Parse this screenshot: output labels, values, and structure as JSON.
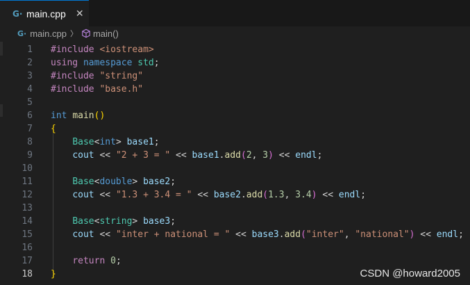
{
  "tab": {
    "label": "main.cpp",
    "close": "✕"
  },
  "breadcrumb": {
    "file": "main.cpp",
    "separator": "〉",
    "symbol": "main()"
  },
  "editor": {
    "active_line": 18,
    "line_numbers": [
      "1",
      "2",
      "3",
      "4",
      "5",
      "6",
      "7",
      "8",
      "9",
      "10",
      "11",
      "12",
      "13",
      "14",
      "15",
      "16",
      "17",
      "18"
    ],
    "lines": [
      [
        [
          "pp",
          "#include "
        ],
        [
          "str",
          "<iostream>"
        ]
      ],
      [
        [
          "pp",
          "using "
        ],
        [
          "kw",
          "namespace "
        ],
        [
          "ty",
          "std"
        ],
        [
          "op",
          ";"
        ]
      ],
      [
        [
          "pp",
          "#include "
        ],
        [
          "str",
          "\"string\""
        ]
      ],
      [
        [
          "pp",
          "#include "
        ],
        [
          "str",
          "\"base.h\""
        ]
      ],
      [],
      [
        [
          "kw",
          "int "
        ],
        [
          "fn",
          "main"
        ],
        [
          "br1",
          "()"
        ]
      ],
      [
        [
          "br1",
          "{"
        ]
      ],
      [
        [
          "op",
          "    "
        ],
        [
          "ty",
          "Base"
        ],
        [
          "op",
          "<"
        ],
        [
          "kw",
          "int"
        ],
        [
          "op",
          "> "
        ],
        [
          "var",
          "base1"
        ],
        [
          "op",
          ";"
        ]
      ],
      [
        [
          "op",
          "    "
        ],
        [
          "var",
          "cout"
        ],
        [
          "op",
          " << "
        ],
        [
          "str",
          "\"2 + 3 = \""
        ],
        [
          "op",
          " << "
        ],
        [
          "var",
          "base1"
        ],
        [
          "op",
          "."
        ],
        [
          "fn",
          "add"
        ],
        [
          "br2",
          "("
        ],
        [
          "num",
          "2"
        ],
        [
          "op",
          ", "
        ],
        [
          "num",
          "3"
        ],
        [
          "br2",
          ")"
        ],
        [
          "op",
          " << "
        ],
        [
          "var",
          "endl"
        ],
        [
          "op",
          ";"
        ]
      ],
      [],
      [
        [
          "op",
          "    "
        ],
        [
          "ty",
          "Base"
        ],
        [
          "op",
          "<"
        ],
        [
          "kw",
          "double"
        ],
        [
          "op",
          "> "
        ],
        [
          "var",
          "base2"
        ],
        [
          "op",
          ";"
        ]
      ],
      [
        [
          "op",
          "    "
        ],
        [
          "var",
          "cout"
        ],
        [
          "op",
          " << "
        ],
        [
          "str",
          "\"1.3 + 3.4 = \""
        ],
        [
          "op",
          " << "
        ],
        [
          "var",
          "base2"
        ],
        [
          "op",
          "."
        ],
        [
          "fn",
          "add"
        ],
        [
          "br2",
          "("
        ],
        [
          "num",
          "1.3"
        ],
        [
          "op",
          ", "
        ],
        [
          "num",
          "3.4"
        ],
        [
          "br2",
          ")"
        ],
        [
          "op",
          " << "
        ],
        [
          "var",
          "endl"
        ],
        [
          "op",
          ";"
        ]
      ],
      [],
      [
        [
          "op",
          "    "
        ],
        [
          "ty",
          "Base"
        ],
        [
          "op",
          "<"
        ],
        [
          "ty",
          "string"
        ],
        [
          "op",
          "> "
        ],
        [
          "var",
          "base3"
        ],
        [
          "op",
          ";"
        ]
      ],
      [
        [
          "op",
          "    "
        ],
        [
          "var",
          "cout"
        ],
        [
          "op",
          " << "
        ],
        [
          "str",
          "\"inter + national = \""
        ],
        [
          "op",
          " << "
        ],
        [
          "var",
          "base3"
        ],
        [
          "op",
          "."
        ],
        [
          "fn",
          "add"
        ],
        [
          "br2",
          "("
        ],
        [
          "str",
          "\"inter\""
        ],
        [
          "op",
          ", "
        ],
        [
          "str",
          "\"national\""
        ],
        [
          "br2",
          ")"
        ],
        [
          "op",
          " << "
        ],
        [
          "var",
          "endl"
        ],
        [
          "op",
          ";"
        ]
      ],
      [],
      [
        [
          "op",
          "    "
        ],
        [
          "pp",
          "return "
        ],
        [
          "num",
          "0"
        ],
        [
          "op",
          ";"
        ]
      ],
      [
        [
          "br1",
          "}"
        ]
      ]
    ]
  },
  "watermark": "CSDN @howard2005"
}
